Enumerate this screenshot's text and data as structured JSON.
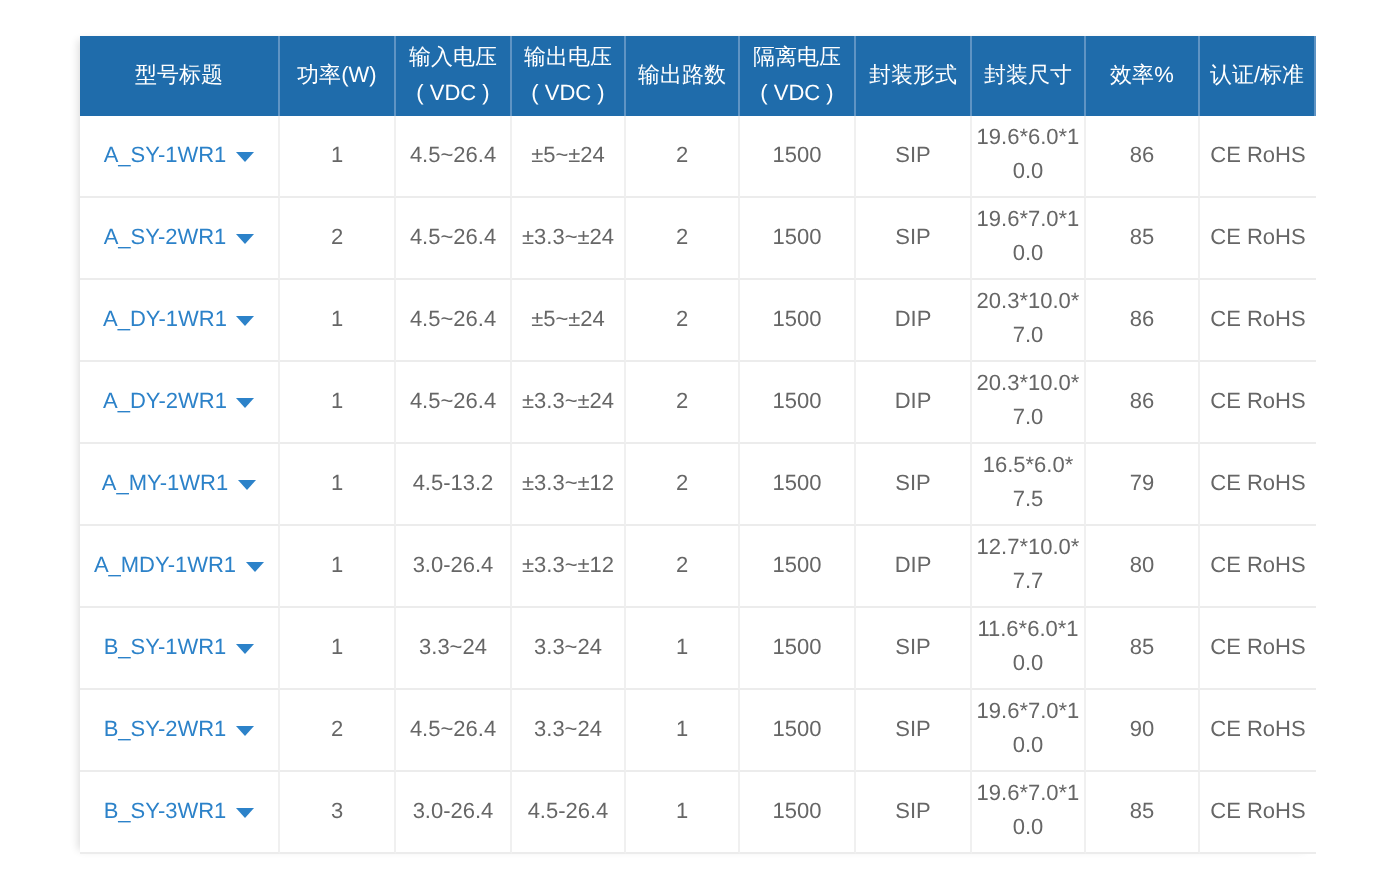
{
  "table": {
    "columns": [
      {
        "lines": [
          "型号标题"
        ]
      },
      {
        "lines": [
          "功率(W)"
        ]
      },
      {
        "lines": [
          "输入电压",
          "( VDC )"
        ]
      },
      {
        "lines": [
          "输出电压",
          "( VDC )"
        ]
      },
      {
        "lines": [
          "输出路数"
        ]
      },
      {
        "lines": [
          "隔离电压",
          "( VDC )"
        ]
      },
      {
        "lines": [
          "封装形式"
        ]
      },
      {
        "lines": [
          "封装尺寸"
        ]
      },
      {
        "lines": [
          "效率%"
        ]
      },
      {
        "lines": [
          "认证/标准"
        ]
      }
    ],
    "rows": [
      {
        "cells": [
          "A_SY-1WR1",
          "1",
          "4.5~26.4",
          "±5~±24",
          "2",
          "1500",
          "SIP",
          "19.6*6.0*10.0",
          "86",
          "CE RoHS"
        ]
      },
      {
        "cells": [
          "A_SY-2WR1",
          "2",
          "4.5~26.4",
          "±3.3~±24",
          "2",
          "1500",
          "SIP",
          "19.6*7.0*10.0",
          "85",
          "CE RoHS"
        ]
      },
      {
        "cells": [
          "A_DY-1WR1",
          "1",
          "4.5~26.4",
          "±5~±24",
          "2",
          "1500",
          "DIP",
          "20.3*10.0*7.0",
          "86",
          "CE RoHS"
        ]
      },
      {
        "cells": [
          "A_DY-2WR1",
          "1",
          "4.5~26.4",
          "±3.3~±24",
          "2",
          "1500",
          "DIP",
          "20.3*10.0*7.0",
          "86",
          "CE RoHS"
        ]
      },
      {
        "cells": [
          "A_MY-1WR1",
          "1",
          "4.5-13.2",
          "±3.3~±12",
          "2",
          "1500",
          "SIP",
          "16.5*6.0*7.5",
          "79",
          "CE RoHS"
        ]
      },
      {
        "cells": [
          "A_MDY-1WR1",
          "1",
          "3.0-26.4",
          "±3.3~±12",
          "2",
          "1500",
          "DIP",
          "12.7*10.0*7.7",
          "80",
          "CE RoHS"
        ]
      },
      {
        "cells": [
          "B_SY-1WR1",
          "1",
          "3.3~24",
          "3.3~24",
          "1",
          "1500",
          "SIP",
          "11.6*6.0*10.0",
          "85",
          "CE RoHS"
        ]
      },
      {
        "cells": [
          "B_SY-2WR1",
          "2",
          "4.5~26.4",
          "3.3~24",
          "1",
          "1500",
          "SIP",
          "19.6*7.0*10.0",
          "90",
          "CE RoHS"
        ]
      },
      {
        "cells": [
          "B_SY-3WR1",
          "3",
          "3.0-26.4",
          "4.5-26.4",
          "1",
          "1500",
          "SIP",
          "19.6*7.0*10.0",
          "85",
          "CE RoHS"
        ]
      }
    ]
  }
}
